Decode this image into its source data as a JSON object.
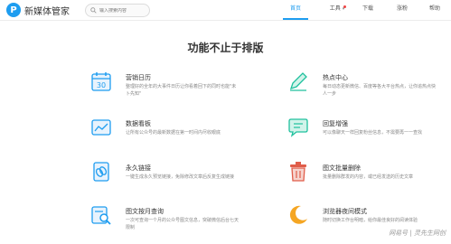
{
  "header": {
    "logo_letter": "P",
    "logo_text": "新媒体管家",
    "search_placeholder": "输入搜索内容",
    "nav": [
      "首页",
      "工具",
      "下载",
      "涨粉",
      "帮助"
    ],
    "active_nav": "首页"
  },
  "page_title": "功能不止于排版",
  "features": [
    {
      "title": "营销日历",
      "desc": "整理好的全年的大事件日历让你看着回下的同时也能\"未卜先知\""
    },
    {
      "title": "热点中心",
      "desc": "每日动态更新微信、百度等各大平台热点，让你追热点快人一步"
    },
    {
      "title": "数据看板",
      "desc": "让所有公众号的最新数据在第一时间内尽收眼底"
    },
    {
      "title": "回复增强",
      "desc": "可以像聊天一样回复粉丝信息，不需要再一一查找"
    },
    {
      "title": "永久链接",
      "desc": "一键生成永久预览链接，免除修改文章后反复生成链接"
    },
    {
      "title": "图文批量删除",
      "desc": "批量删除群发的内容，或已经发送的历史文章"
    },
    {
      "title": "图文按月查询",
      "desc": "一次可查询一个月的公众号图文信息，突破微信后台七天限制"
    },
    {
      "title": "浏览器夜间模式",
      "desc": "随时切换工作台明暗，给你最佳良好的阅读体验"
    }
  ],
  "watermark": "网易号 | 灵先生网创",
  "colors": {
    "brand": "#1e9df0",
    "icon_bg": "#e8f3fd",
    "teal": "#20c19e",
    "red": "#e05d4a",
    "orange": "#f5a623"
  }
}
